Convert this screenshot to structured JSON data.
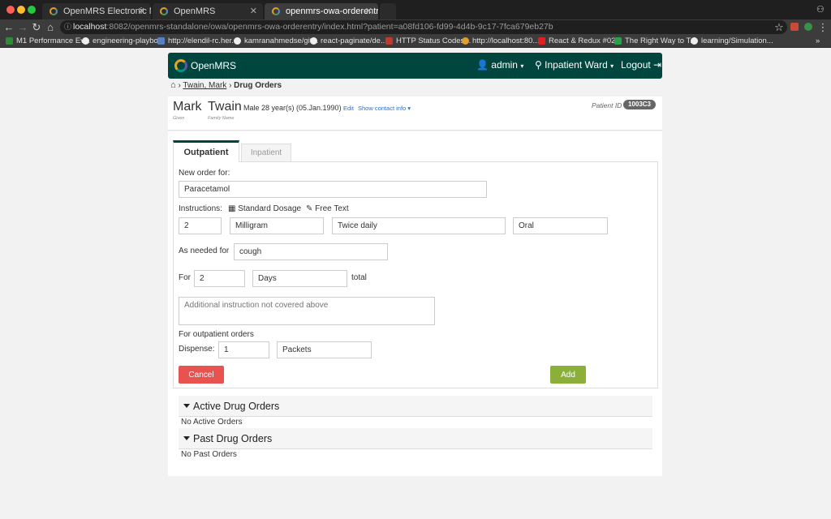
{
  "browser": {
    "tabs": [
      {
        "title": "OpenMRS Electronic Medical R"
      },
      {
        "title": "OpenMRS"
      },
      {
        "title": "openmrs-owa-orderentry"
      }
    ],
    "url_host": "localhost",
    "url_rest": ":8082/openmrs-standalone/owa/openmrs-owa-orderentry/index.html?patient=a08fd106-fd99-4d4b-9c17-7fca679eb27b",
    "bookmarks": [
      "M1 Performance Ev...",
      "engineering-playbo...",
      "http://elendil-rc.her...",
      "kamranahmedse/git...",
      "react-paginate/de...",
      "HTTP Status Codes...",
      "http://localhost:80...",
      "React & Redux #02...",
      "The Right Way to T...",
      "learning/Simulation..."
    ],
    "bookmark_more": "»"
  },
  "header": {
    "brand": "OpenMRS",
    "user": "admin",
    "location": "Inpatient Ward",
    "logout": "Logout"
  },
  "breadcrumb": {
    "patient": "Twain, Mark",
    "current": "Drug Orders"
  },
  "patient": {
    "given": "Mark",
    "family": "Twain",
    "given_label": "Given",
    "family_label": "Family Name",
    "demographics": "Male 28 year(s) (05.Jan.1990)",
    "edit": "Edit",
    "contact": "Show contact info",
    "id_label": "Patient ID",
    "id": "1003C3"
  },
  "tabs": {
    "outpatient": "Outpatient",
    "inpatient": "Inpatient"
  },
  "form": {
    "new_order_label": "New order for:",
    "drug": "Paracetamol",
    "instructions_label": "Instructions:",
    "standard_dosage": "Standard Dosage",
    "free_text": "Free Text",
    "dose": "2",
    "dose_unit": "Milligram",
    "frequency": "Twice daily",
    "route": "Oral",
    "as_needed_label": "As needed for",
    "as_needed": "cough",
    "for_label": "For",
    "duration": "2",
    "duration_unit": "Days",
    "total_label": "total",
    "additional_placeholder": "Additional instruction not covered above",
    "outpatient_orders_label": "For outpatient orders",
    "dispense_label": "Dispense:",
    "dispense_qty": "1",
    "dispense_unit": "Packets",
    "cancel": "Cancel",
    "add": "Add"
  },
  "active_orders": {
    "title": "Active Drug Orders",
    "empty": "No Active Orders"
  },
  "past_orders": {
    "title": "Past Drug Orders",
    "empty": "No Past Orders"
  },
  "colors": {
    "header_bg": "#00463f",
    "cancel": "#e9534f",
    "add": "#8ab03a",
    "link": "#2b6ec8"
  }
}
